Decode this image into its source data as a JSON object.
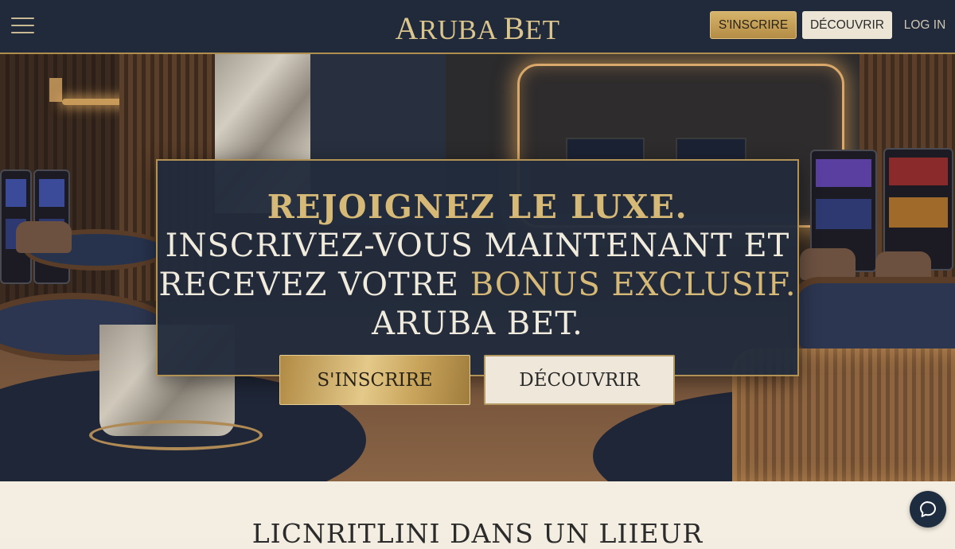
{
  "header": {
    "logo": {
      "first_letter": "A",
      "rest_word1": "RUBA",
      "space": " ",
      "second_letter": "B",
      "rest_word2": "ET"
    },
    "signup_label": "S'INSCRIRE",
    "discover_label": "DÉCOUVRIR",
    "login_label": "LOG IN",
    "menu_icon": "hamburger-icon"
  },
  "hero": {
    "line1": "Rejoignez le luxe.",
    "line2": "Inscrivez-vous maintenant et",
    "line3_prefix": "recevez votre ",
    "line3_highlight": "bonus exclusif.",
    "line4": "Aruba Bet.",
    "signup_label": "S'INSCRIRE",
    "discover_label": "DÉCOUVRIR"
  },
  "section": {
    "title": "LICNRITLINI DANS UN LIIEUR"
  },
  "chat": {
    "icon": "chat-bubble-icon"
  },
  "colors": {
    "navy": "#202a3a",
    "gold": "#d7b977",
    "cream": "#f3ece0"
  }
}
